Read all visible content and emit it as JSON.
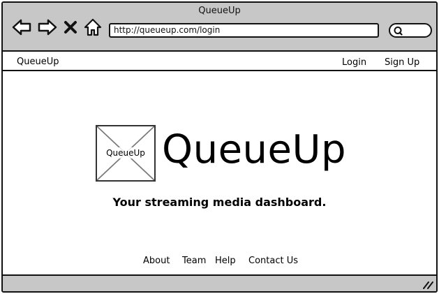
{
  "window": {
    "title": "QueueUp"
  },
  "toolbar": {
    "back_icon": "back-arrow-icon",
    "forward_icon": "forward-arrow-icon",
    "stop_icon": "close-icon",
    "home_icon": "home-icon",
    "url": "http://queueup.com/login",
    "search_icon": "search-icon"
  },
  "menubar": {
    "brand": "QueueUp",
    "login_label": "Login",
    "signup_label": "Sign Up"
  },
  "hero": {
    "logo_label": "QueueUp",
    "title": "QueueUp",
    "tagline": "Your streaming media dashboard."
  },
  "footer": {
    "about": "About",
    "team": "Team",
    "help": "Help",
    "contact": "Contact Us"
  },
  "colors": {
    "chrome": "#c7c7c7",
    "border": "#111111",
    "background": "#ffffff"
  }
}
